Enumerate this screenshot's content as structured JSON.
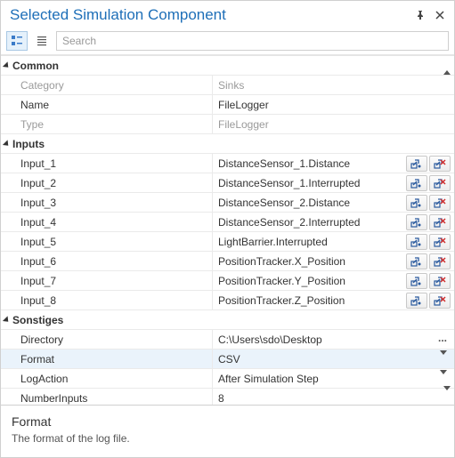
{
  "title": "Selected Simulation Component",
  "search": {
    "placeholder": "Search"
  },
  "categories": [
    {
      "name": "Common",
      "rows": [
        {
          "label": "Category",
          "value": "Sinks",
          "dim": true
        },
        {
          "label": "Name",
          "value": "FileLogger"
        },
        {
          "label": "Type",
          "value": "FileLogger",
          "dim": true
        }
      ]
    },
    {
      "name": "Inputs",
      "rows": [
        {
          "label": "Input_1",
          "value": "DistanceSensor_1.Distance",
          "actions": true
        },
        {
          "label": "Input_2",
          "value": "DistanceSensor_1.Interrupted",
          "actions": true
        },
        {
          "label": "Input_3",
          "value": "DistanceSensor_2.Distance",
          "actions": true
        },
        {
          "label": "Input_4",
          "value": "DistanceSensor_2.Interrupted",
          "actions": true
        },
        {
          "label": "Input_5",
          "value": "LightBarrier.Interrupted",
          "actions": true
        },
        {
          "label": "Input_6",
          "value": "PositionTracker.X_Position",
          "actions": true
        },
        {
          "label": "Input_7",
          "value": "PositionTracker.Y_Position",
          "actions": true
        },
        {
          "label": "Input_8",
          "value": "PositionTracker.Z_Position",
          "actions": true
        }
      ]
    },
    {
      "name": "Sonstiges",
      "rows": [
        {
          "label": "Directory",
          "value": "C:\\Users\\sdo\\Desktop",
          "ellipsis": true
        },
        {
          "label": "Format",
          "value": "CSV",
          "dropdown": true,
          "selected": true
        },
        {
          "label": "LogAction",
          "value": "After Simulation Step",
          "dropdown": true
        },
        {
          "label": "NumberInputs",
          "value": "8"
        }
      ]
    }
  ],
  "description": {
    "title": "Format",
    "text": "The format of the log file."
  }
}
